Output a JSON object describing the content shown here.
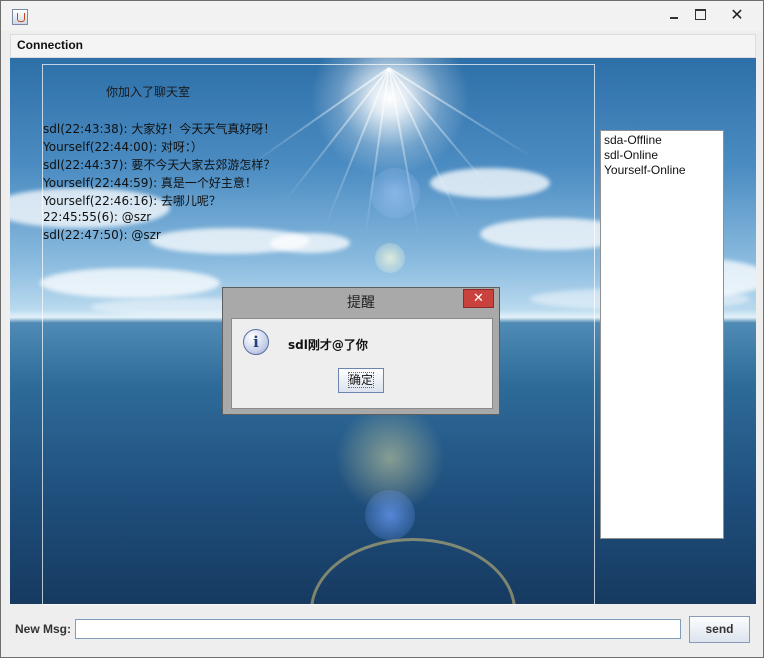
{
  "window": {
    "icon": "java-cup-icon",
    "controls": {
      "minimize": "–",
      "maximize": "☐",
      "close": "✕"
    }
  },
  "menubar": {
    "items": [
      "Connection"
    ]
  },
  "chat": {
    "joined_notice": "你加入了聊天室",
    "messages": [
      "sdl(22:43:38): 大家好！今天天气真好呀！",
      "Yourself(22:44:00): 对呀：）",
      "sdl(22:44:37): 要不今天大家去郊游怎样？",
      "Yourself(22:44:59): 真是一个好主意！",
      "Yourself(22:46:16): 去哪儿呢？",
      "22:45:55(6): @szr",
      "sdl(22:47:50): @szr"
    ]
  },
  "users": [
    "sda-Offline",
    "sdl-Online",
    "Yourself-Online"
  ],
  "dialog": {
    "title": "提醒",
    "close": "✕",
    "icon": "info-icon",
    "icon_glyph": "i",
    "message": "sdl刚才@了你",
    "ok_label": "确定"
  },
  "footer": {
    "label": "New Msg:",
    "input_value": "",
    "send_label": "send"
  },
  "colors": {
    "dialog_close": "#c9423e",
    "input_border": "#7f9db9"
  }
}
